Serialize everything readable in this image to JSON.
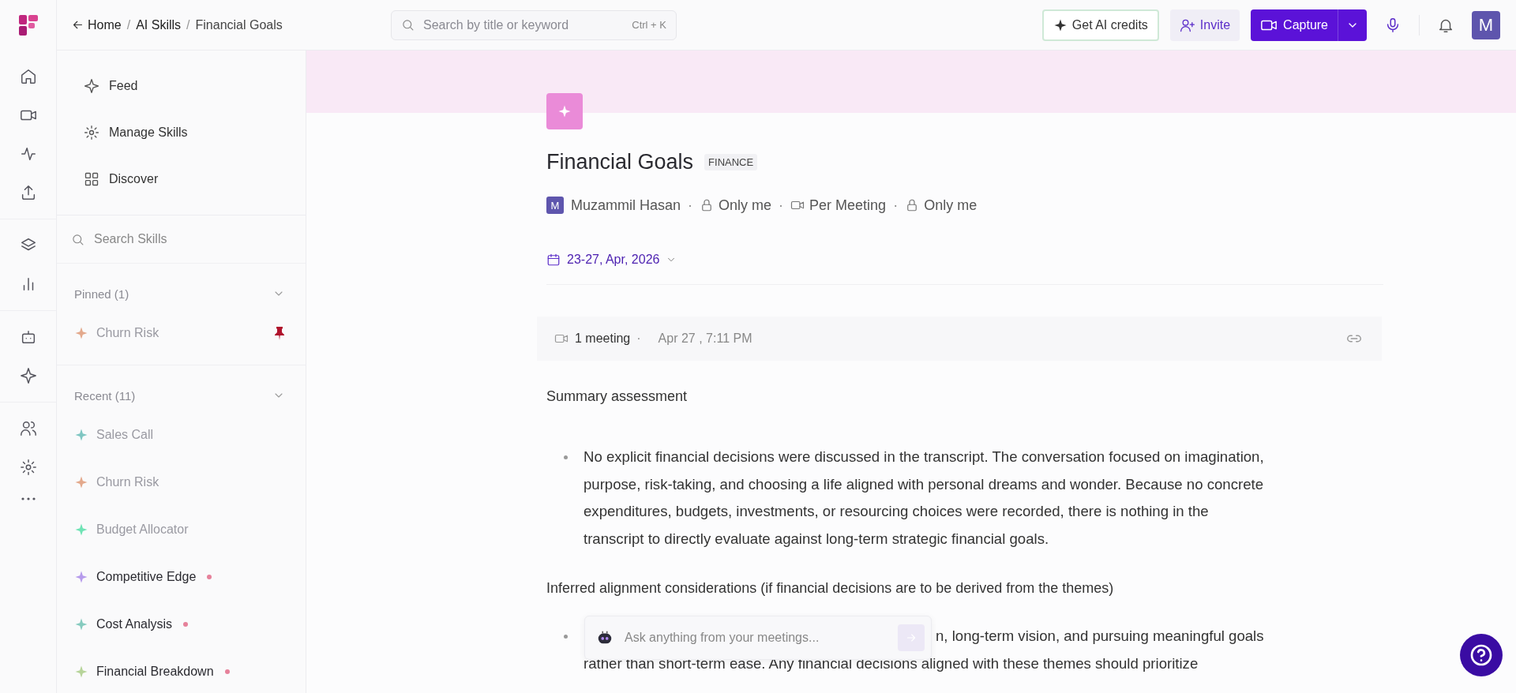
{
  "breadcrumb": {
    "items": [
      "Home",
      "AI Skills",
      "Financial Goals"
    ],
    "separator": "/"
  },
  "search": {
    "placeholder": "Search by title or keyword",
    "shortcut": "Ctrl + K"
  },
  "actions": {
    "credits": "Get AI credits",
    "invite": "Invite",
    "capture": "Capture",
    "avatar": "M"
  },
  "skills_nav": {
    "items": [
      "Feed",
      "Manage Skills",
      "Discover"
    ]
  },
  "skills_search": {
    "placeholder": "Search Skills"
  },
  "pinned": {
    "title": "Pinned (1)",
    "expanded": true,
    "items": [
      {
        "label": "Churn Risk",
        "color": "#e3a98c",
        "dimmed": true,
        "pinned": true
      }
    ]
  },
  "recent": {
    "title": "Recent (11)",
    "expanded": true,
    "items": [
      {
        "label": "Sales Call",
        "color": "#7fc6c2",
        "dimmed": true,
        "unread": false
      },
      {
        "label": "Churn Risk",
        "color": "#e3a98c",
        "dimmed": true,
        "unread": false
      },
      {
        "label": "Budget Allocator",
        "color": "#6fe3b5",
        "dimmed": true,
        "unread": false
      },
      {
        "label": "Competitive Edge",
        "color": "#b69bec",
        "dimmed": false,
        "unread": true
      },
      {
        "label": "Cost Analysis",
        "color": "#86cbbf",
        "dimmed": false,
        "unread": true
      },
      {
        "label": "Financial Breakdown",
        "color": "#b7d49a",
        "dimmed": false,
        "unread": true
      }
    ]
  },
  "page": {
    "title": "Financial Goals",
    "tag": "FINANCE",
    "owner_initial": "M",
    "owner": "Muzammil Hasan",
    "separator": "·",
    "meta": [
      {
        "kind": "lock",
        "label": "Only me"
      },
      {
        "kind": "video",
        "label": "Per Meeting"
      },
      {
        "kind": "lock",
        "label": "Only me"
      }
    ],
    "date_range": "23-27, Apr, 2026",
    "meeting": {
      "count": "1 meeting",
      "separator": "·",
      "time": "Apr 27 , 7:11 PM"
    },
    "blocks": [
      {
        "kind": "heading",
        "text": "Summary assessment"
      },
      {
        "kind": "bullet",
        "text": "No explicit financial decisions were discussed in the transcript. The conversation focused on imagination, purpose, risk-taking, and choosing a life aligned with personal dreams and wonder. Because no concrete expenditures, budgets, investments, or resourcing choices were recorded, there is nothing in the transcript to directly evaluate against long-term strategic financial goals."
      },
      {
        "kind": "heading",
        "text": "Inferred alignment considerations (if financial decisions are to be derived from the themes)"
      },
      {
        "kind": "partial_bullet",
        "lines": [
          "n, long-term vision, and pursuing meaningful goals",
          "rather than short-term ease. Any financial decisions aligned with these themes should prioritize"
        ]
      }
    ]
  },
  "chat": {
    "placeholder": "Ask anything from your meetings..."
  }
}
